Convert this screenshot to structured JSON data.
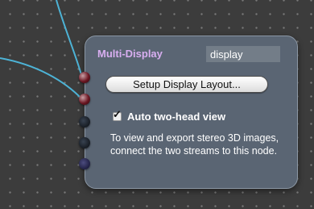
{
  "node": {
    "title": "Multi-Display",
    "name_value": "display",
    "setup_button_label": "Setup Display Layout...",
    "auto_two_head": {
      "label": "Auto two-head view",
      "checked": true
    },
    "info_text": "To view and export stereo 3D images, connect the two streams to this node."
  },
  "ports": [
    "input-connected",
    "input-connected",
    "input-empty",
    "input-empty",
    "output"
  ],
  "colors": {
    "wire": "#4db3d6",
    "node_body": "#5a6573",
    "title": "#d8aef0",
    "canvas_background": "#3c3c3c"
  }
}
